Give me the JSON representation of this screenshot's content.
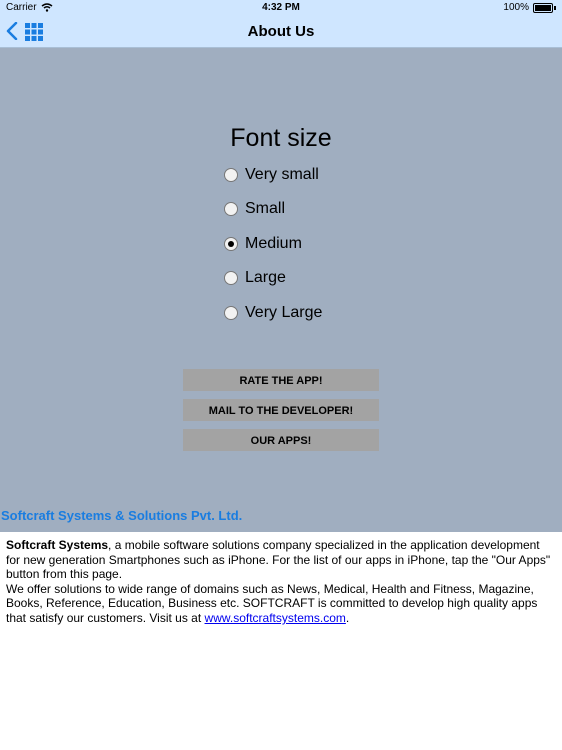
{
  "status_bar": {
    "carrier": "Carrier",
    "time": "4:32 PM",
    "battery": "100%"
  },
  "nav": {
    "title": "About Us"
  },
  "font_size": {
    "title": "Font size",
    "options": [
      {
        "label": "Very small",
        "checked": false
      },
      {
        "label": "Small",
        "checked": false
      },
      {
        "label": "Medium",
        "checked": true
      },
      {
        "label": "Large",
        "checked": false
      },
      {
        "label": "Very Large",
        "checked": false
      }
    ]
  },
  "buttons": {
    "rate": "RATE THE APP!",
    "mail": "MAIL TO THE DEVELOPER!",
    "apps": "OUR APPS!"
  },
  "company_name": "Softcraft Systems & Solutions Pvt. Ltd.",
  "about": {
    "company_bold": "Softcraft Systems",
    "line1": ", a mobile software solutions company specialized in the application development for new generation Smartphones such as iPhone. For the list of our apps in iPhone, tap the \"Our Apps\" button from this page.",
    "line2": "We offer solutions to wide range of domains such as News, Medical, Health and Fitness, Magazine, Books, Reference, Education, Business etc. SOFTCRAFT is committed to develop high quality apps that satisfy our customers. Visit us at ",
    "link_text": "www.softcraftsystems.com",
    "end": "."
  },
  "colors": {
    "navbar": "#cfe6ff",
    "panel": "#a0aec0",
    "button": "#a3a3a3",
    "company": "#1a7de0",
    "accent": "#1a7de0"
  }
}
